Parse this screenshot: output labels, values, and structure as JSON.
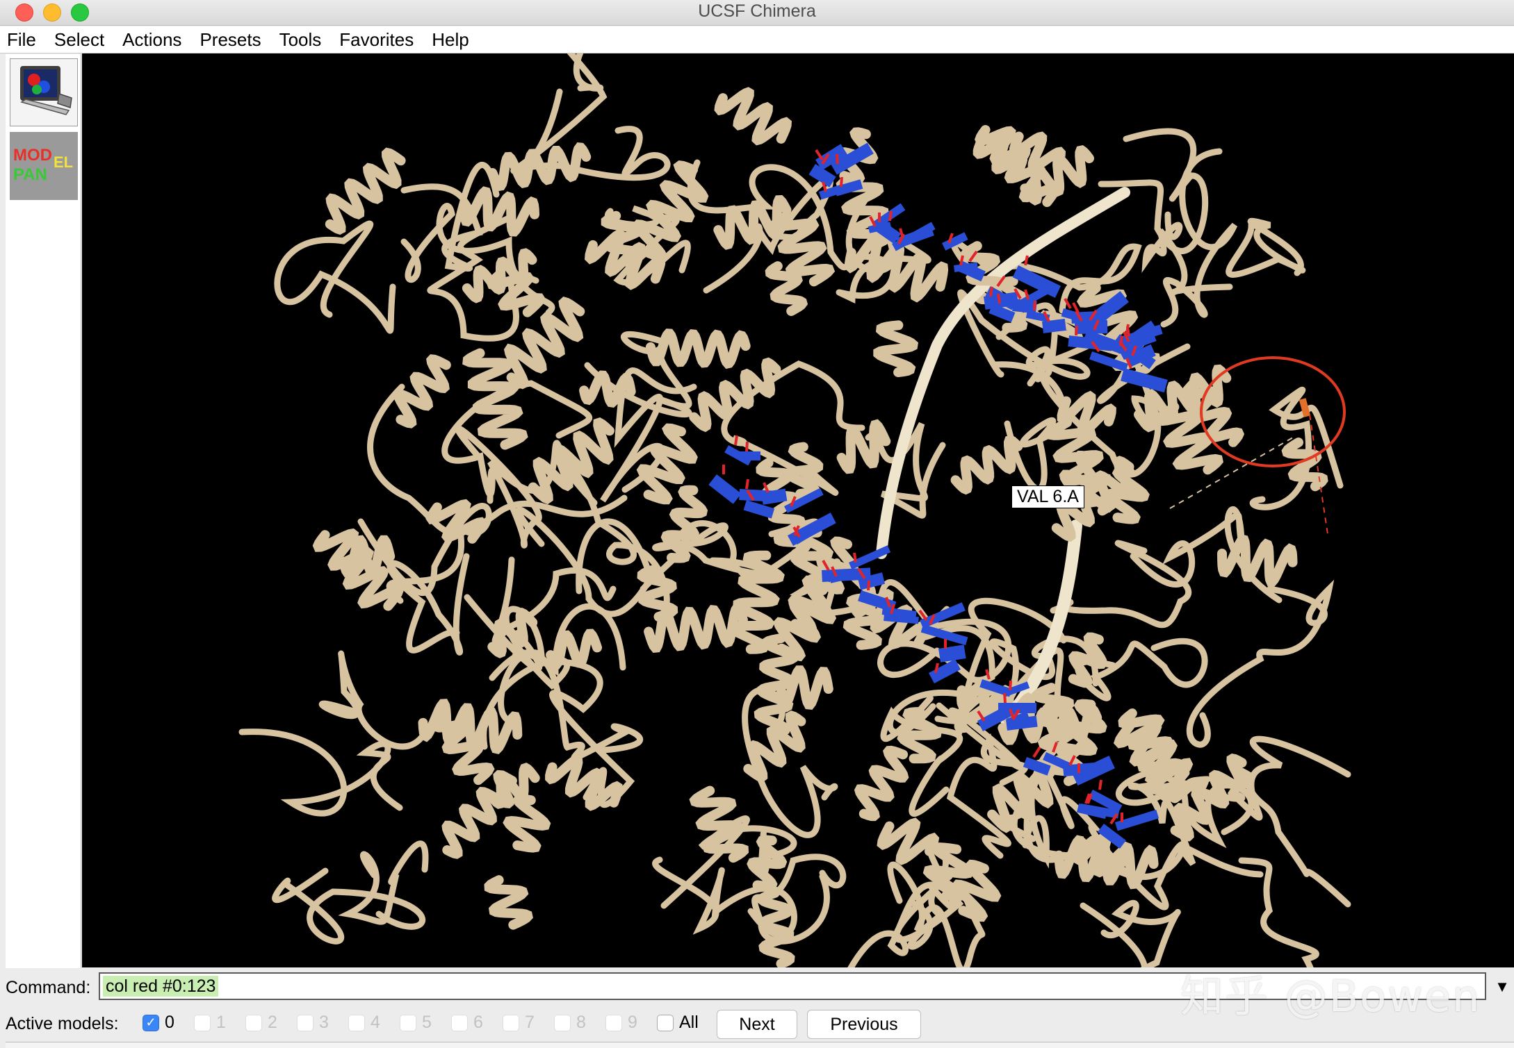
{
  "window": {
    "title": "UCSF Chimera"
  },
  "menubar": {
    "items": [
      "File",
      "Select",
      "Actions",
      "Presets",
      "Tools",
      "Favorites",
      "Help"
    ]
  },
  "toolbar": {
    "buttons": [
      {
        "icon": "chimera-monitor-icon"
      },
      {
        "icon": "model-panel-icon",
        "text_line1": "MOD",
        "text_line1b": "EL",
        "text_line2": "PAN"
      }
    ]
  },
  "viewer": {
    "background": "#000000",
    "ribbon_color": "#d8c3a0",
    "nucleotide_color": "#2a4fd6",
    "highlight_circle_color": "#e03a22",
    "atom_label": "VAL 6.A"
  },
  "command": {
    "label": "Command:",
    "value": "col red #0:123",
    "dropdown_icon": "dropdown-arrow-icon"
  },
  "watermark": "知乎 @Bowen",
  "active_models": {
    "label": "Active models:",
    "models": [
      {
        "label": "0",
        "checked": true,
        "enabled": true
      },
      {
        "label": "1",
        "checked": false,
        "enabled": false
      },
      {
        "label": "2",
        "checked": false,
        "enabled": false
      },
      {
        "label": "3",
        "checked": false,
        "enabled": false
      },
      {
        "label": "4",
        "checked": false,
        "enabled": false
      },
      {
        "label": "5",
        "checked": false,
        "enabled": false
      },
      {
        "label": "6",
        "checked": false,
        "enabled": false
      },
      {
        "label": "7",
        "checked": false,
        "enabled": false
      },
      {
        "label": "8",
        "checked": false,
        "enabled": false
      },
      {
        "label": "9",
        "checked": false,
        "enabled": false
      }
    ],
    "all_label": "All",
    "next_label": "Next",
    "previous_label": "Previous"
  }
}
